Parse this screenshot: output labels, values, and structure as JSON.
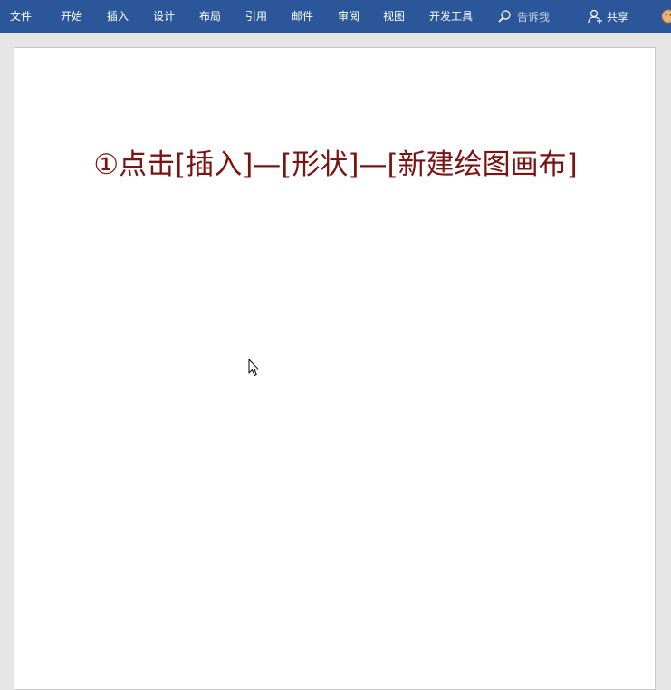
{
  "ribbon": {
    "tabs": [
      "文件",
      "开始",
      "插入",
      "设计",
      "布局",
      "引用",
      "邮件",
      "审阅",
      "视图",
      "开发工具"
    ],
    "search_placeholder": "告诉我",
    "share_label": "共享"
  },
  "document": {
    "instruction": "①点击[插入]—[形状]—[新建绘图画布]"
  },
  "colors": {
    "ribbon_bg": "#2b579a",
    "instruction_text": "#7b1313",
    "page_bg": "#ffffff",
    "workspace_bg": "#e6e6e6"
  },
  "icons": {
    "search": "search-icon",
    "share": "person-add-icon",
    "feedback": "smiley-icon",
    "cursor": "mouse-pointer-icon"
  }
}
